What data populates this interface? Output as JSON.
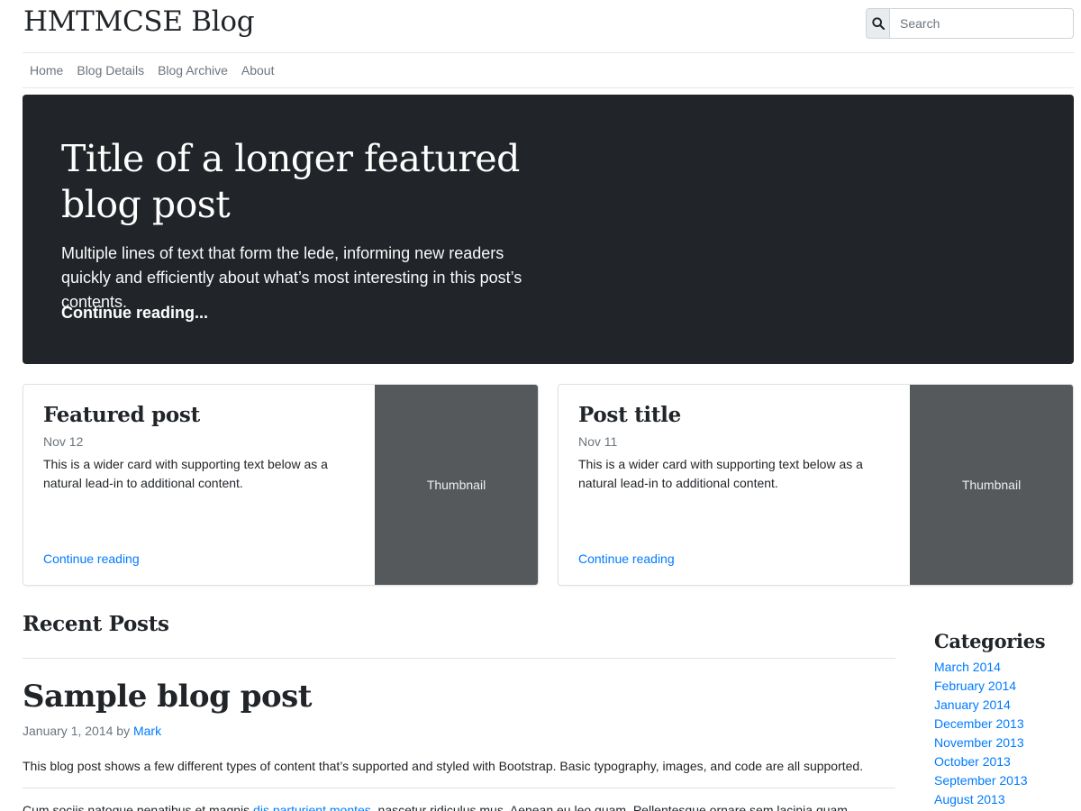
{
  "header": {
    "brand": "HMTMCSE Blog",
    "search_placeholder": "Search",
    "search_icon": "search-icon"
  },
  "nav": {
    "items": [
      "Home",
      "Blog Details",
      "Blog Archive",
      "About"
    ]
  },
  "hero": {
    "title": "Title of a longer featured blog post",
    "lede": "Multiple lines of text that form the lede, informing new readers quickly and efficiently about what’s most interesting in this post’s contents.",
    "link": "Continue reading..."
  },
  "cards": [
    {
      "title": "Featured post",
      "date": "Nov 12",
      "text": "This is a wider card with supporting text below as a natural lead-in to additional content.",
      "link": "Continue reading",
      "thumbnail": "Thumbnail"
    },
    {
      "title": "Post title",
      "date": "Nov 11",
      "text": "This is a wider card with supporting text below as a natural lead-in to additional content.",
      "link": "Continue reading",
      "thumbnail": "Thumbnail"
    }
  ],
  "recent": {
    "heading": "Recent Posts",
    "post": {
      "title": "Sample blog post",
      "date": "January 1, 2014",
      "by": "by",
      "author": "Mark",
      "intro": "This blog post shows a few different types of content that’s supported and styled with Bootstrap. Basic typography, images, and code are all supported.",
      "body_start": "Cum sociis natoque penatibus et magnis",
      "body_link": "dis parturient montes",
      "body_end": ", nascetur ridiculus mus. Aenean eu leo quam. Pellentesque ornare sem lacinia quam"
    }
  },
  "sidebar": {
    "title": "Categories",
    "items": [
      "March 2014",
      "February 2014",
      "January 2014",
      "December 2013",
      "November 2013",
      "October 2013",
      "September 2013",
      "August 2013"
    ]
  },
  "colors": {
    "hero_bg": "#212529",
    "link": "#007bff",
    "thumbnail_bg": "#55595c",
    "muted": "#6c757d"
  }
}
